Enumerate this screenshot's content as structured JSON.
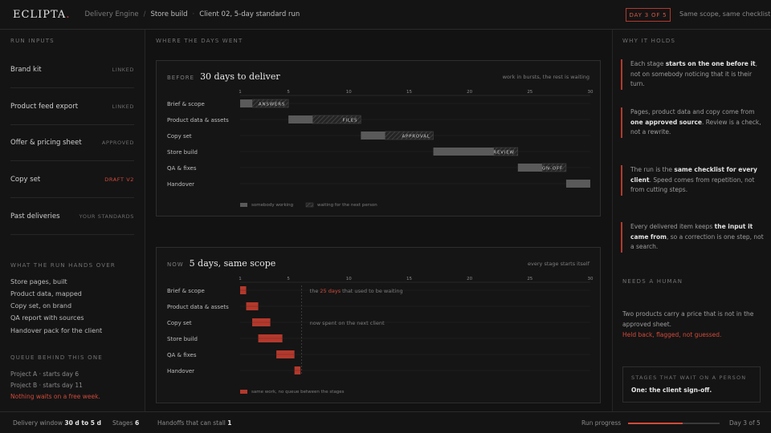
{
  "topbar": {
    "logo": "ECLIPTA",
    "logo_dot": ".",
    "crumb_1": "Delivery Engine",
    "crumb_sep": "/",
    "crumb_2": "Store build",
    "crumb_dot": "·",
    "crumb_3": "Client 02, 5-day standard run",
    "day_badge": "DAY 3 OF 5",
    "note": "Same scope, same checklist"
  },
  "left": {
    "run_inputs_heading": "RUN INPUTS",
    "inputs": [
      {
        "label": "Brand kit",
        "status": "LINKED"
      },
      {
        "label": "Product feed export",
        "status": "LINKED"
      },
      {
        "label": "Offer & pricing sheet",
        "status": "APPROVED"
      },
      {
        "label": "Copy set",
        "status": "DRAFT V2"
      },
      {
        "label": "Past deliveries",
        "status": "YOUR STANDARDS"
      }
    ],
    "hands_over_heading": "WHAT THE RUN HANDS OVER",
    "hands_over": [
      "Store pages, built",
      "Product data, mapped",
      "Copy set, on brand",
      "QA report with sources",
      "Handover pack for the client"
    ],
    "queue_heading": "QUEUE BEHIND THIS ONE",
    "queue": [
      {
        "name": "Project A",
        "dot": "·",
        "when": "starts day 6"
      },
      {
        "name": "Project B",
        "dot": "·",
        "when": "starts day 11"
      }
    ],
    "queue_note": "Nothing waits on a free week."
  },
  "center": {
    "heading": "WHERE THE DAYS WENT",
    "before": {
      "tag": "BEFORE",
      "title": "30 days to deliver",
      "note": "work in bursts, the rest is waiting",
      "legend_working": "somebody working",
      "legend_waiting": "waiting for the next person"
    },
    "now": {
      "tag": "NOW",
      "title": "5 days, same scope",
      "note": "every stage starts itself",
      "annotation_pre": "the ",
      "annotation_red": "25 days",
      "annotation_post": " that used to be waiting",
      "annotation_2": "now spent on the next client",
      "legend": "same work, no queue between the stages"
    }
  },
  "chart_data": [
    {
      "type": "bar",
      "title": "30 days to deliver",
      "x_ticks": [
        1,
        5,
        10,
        15,
        20,
        25,
        30
      ],
      "xlim": [
        1,
        30
      ],
      "categories": [
        "Brief & scope",
        "Product data & assets",
        "Copy set",
        "Store build",
        "QA & fixes",
        "Handover"
      ],
      "series": [
        {
          "name": "somebody working",
          "start": [
            1,
            5,
            11,
            17,
            24,
            28
          ],
          "end": [
            2,
            7,
            13,
            22,
            26,
            30
          ]
        },
        {
          "name": "waiting for the next person",
          "start": [
            2,
            7,
            13,
            22,
            26
          ],
          "end": [
            5,
            11,
            17,
            24,
            28
          ],
          "labels": [
            "ANSWERS",
            "FILES",
            "APPROVAL",
            "REVIEW",
            "SIGN-OFF"
          ]
        }
      ],
      "colors": {
        "working": "#5a5a5a",
        "waiting": "#2e2e2e"
      }
    },
    {
      "type": "bar",
      "title": "5 days, same scope",
      "x_ticks": [
        1,
        5,
        10,
        15,
        20,
        25,
        30
      ],
      "xlim": [
        1,
        30
      ],
      "categories": [
        "Brief & scope",
        "Product data & assets",
        "Copy set",
        "Store build",
        "QA & fixes",
        "Handover"
      ],
      "series": [
        {
          "name": "same work, no queue between the stages",
          "start": [
            1,
            1.5,
            2,
            2.5,
            4,
            5.5
          ],
          "end": [
            1.5,
            2.5,
            3.5,
            4.5,
            5.5,
            6
          ]
        }
      ],
      "colors": {
        "working": "#b3392c"
      }
    }
  ],
  "right": {
    "why_heading": "WHY IT HOLDS",
    "why": [
      {
        "pre": "Each stage ",
        "bold": "starts on the one before it",
        "post": ", not on somebody noticing that it is their turn."
      },
      {
        "pre": "Pages, product data and copy come from ",
        "bold": "one approved source",
        "post": ". Review is a check, not a rewrite."
      },
      {
        "pre": "The run is the ",
        "bold": "same checklist for every client",
        "post": ". Speed comes from repetition, not from cutting steps."
      },
      {
        "pre": "Every delivered item keeps ",
        "bold": "the input it came from",
        "post": ", so a correction is one step, not a search."
      }
    ],
    "human_heading": "NEEDS A HUMAN",
    "human_text": "Two products carry a price that is not in the approved sheet.",
    "human_red": "Held back, flagged, not guessed.",
    "wait_heading": "STAGES THAT WAIT ON A PERSON",
    "wait_value": "One: the client sign-off."
  },
  "bottombar": {
    "window_label": "Delivery window",
    "window_value": "30 d to 5 d",
    "stages_label": "Stages",
    "stages_value": "6",
    "handoffs_label": "Handoffs that can stall",
    "handoffs_value": "1",
    "progress_label": "Run progress",
    "progress_fraction": 0.6,
    "day_label": "Day 3 of 5"
  },
  "colors": {
    "accent": "#d24a3a",
    "bg": "#141414"
  }
}
